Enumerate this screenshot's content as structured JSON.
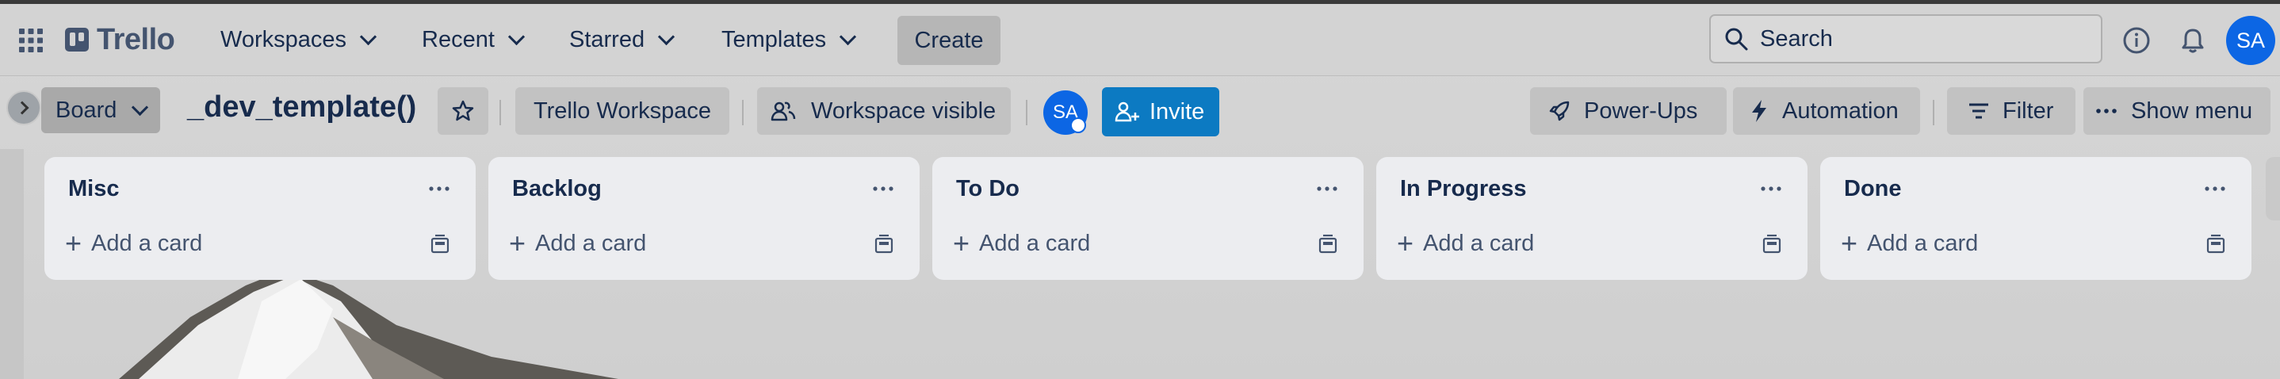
{
  "nav": {
    "brand": "Trello",
    "menus": [
      "Workspaces",
      "Recent",
      "Starred",
      "Templates"
    ],
    "create_label": "Create",
    "search_label": "Search",
    "avatar_initials": "SA"
  },
  "board": {
    "view_label": "Board",
    "title": "_dev_template()",
    "workspace_label": "Trello Workspace",
    "visibility_label": "Workspace visible",
    "member_initials": "SA",
    "invite_label": "Invite",
    "powerups_label": "Power-Ups",
    "automation_label": "Automation",
    "filter_label": "Filter",
    "show_menu_label": "Show menu"
  },
  "lists": [
    {
      "title": "Misc",
      "add_card": "Add a card"
    },
    {
      "title": "Backlog",
      "add_card": "Add a card"
    },
    {
      "title": "To Do",
      "add_card": "Add a card"
    },
    {
      "title": "In Progress",
      "add_card": "Add a card"
    },
    {
      "title": "Done",
      "add_card": "Add a card"
    }
  ],
  "colors": {
    "accent_blue": "#0c66e4",
    "invite_blue": "#0c7ac2",
    "text_dark": "#172b4d",
    "list_bg": "#ecedf0"
  }
}
